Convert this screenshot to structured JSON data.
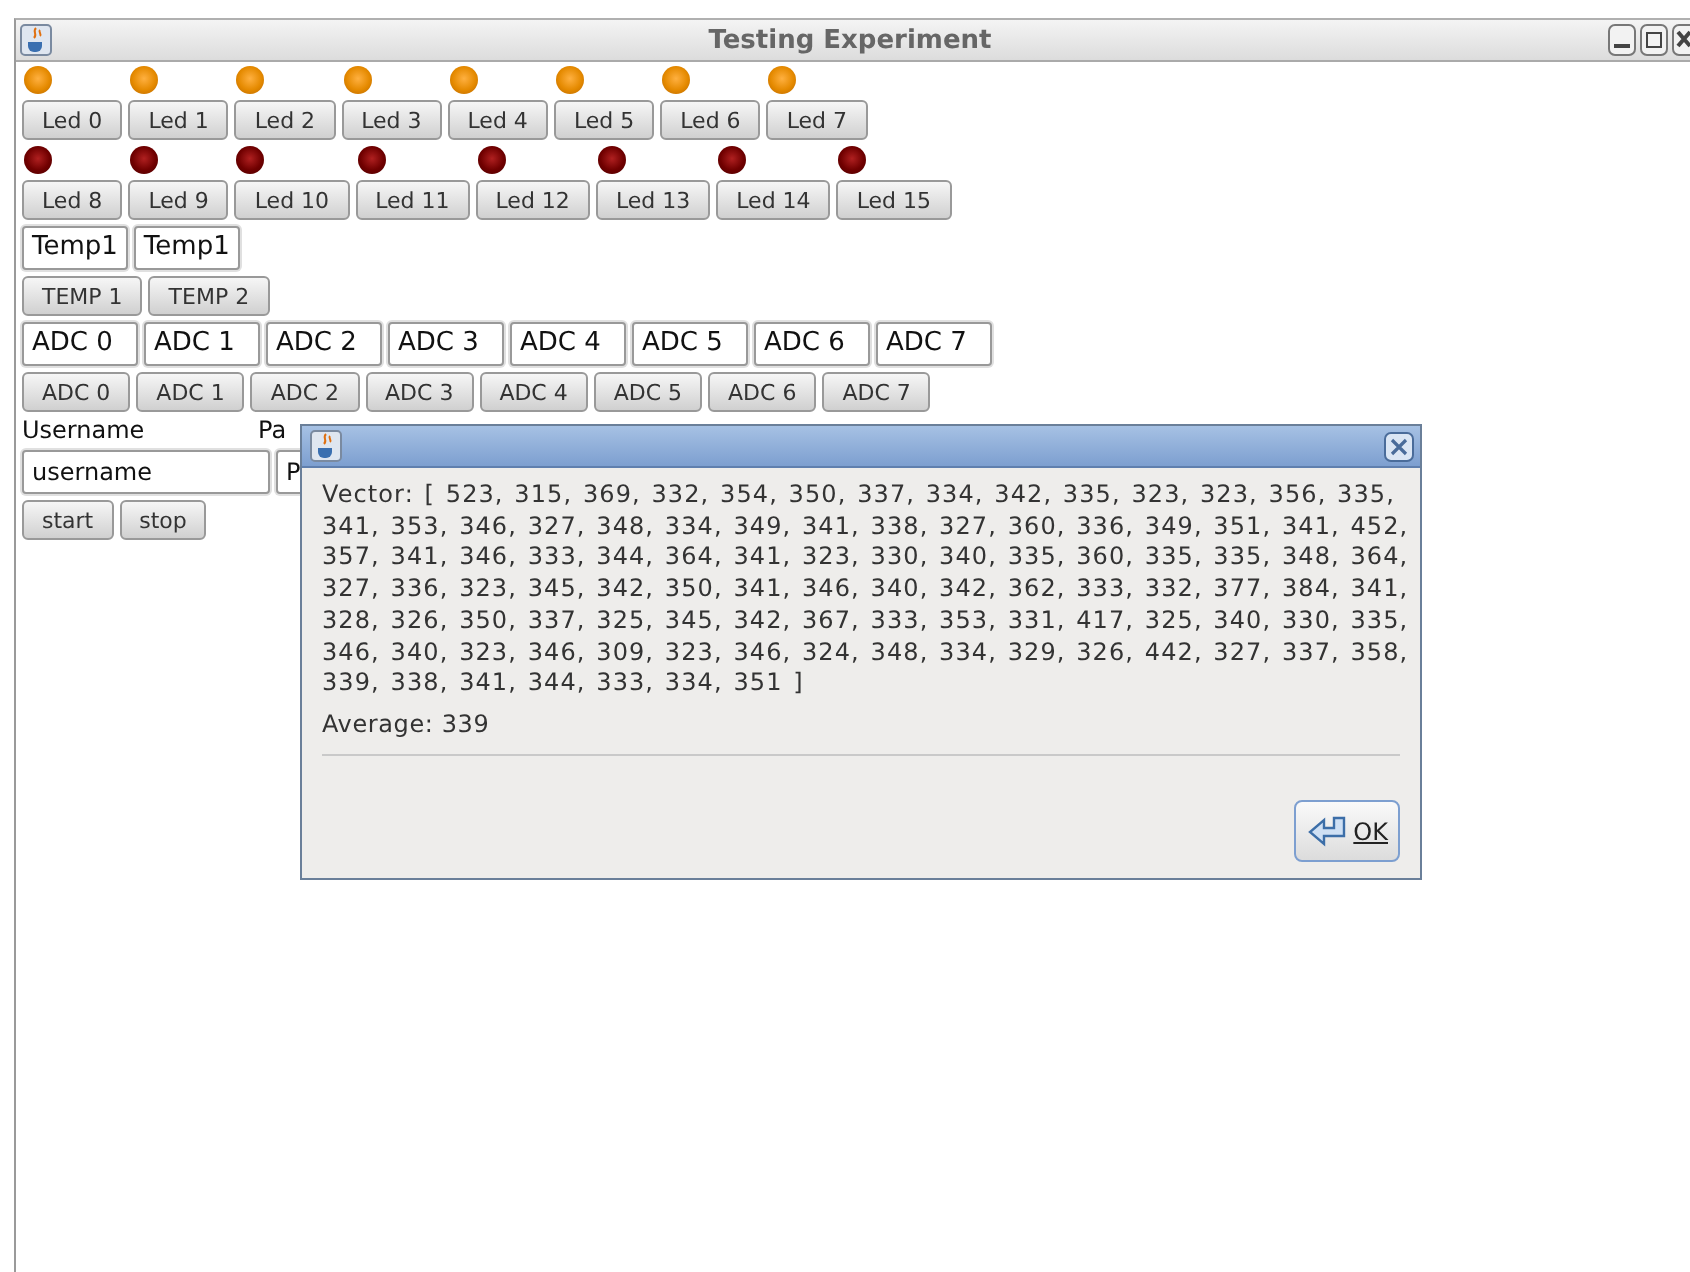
{
  "window": {
    "title": "Testing Experiment"
  },
  "led_rows": [
    {
      "leds": [
        {
          "on": true
        },
        {
          "on": true
        },
        {
          "on": true
        },
        {
          "on": true
        },
        {
          "on": true
        },
        {
          "on": true
        },
        {
          "on": true
        },
        {
          "on": true
        }
      ],
      "buttons": [
        "Led 0",
        "Led 1",
        "Led 2",
        "Led 3",
        "Led 4",
        "Led 5",
        "Led 6",
        "Led 7"
      ]
    },
    {
      "leds": [
        {
          "on": false
        },
        {
          "on": false
        },
        {
          "on": false
        },
        {
          "on": false
        },
        {
          "on": false
        },
        {
          "on": false
        },
        {
          "on": false
        },
        {
          "on": false
        }
      ],
      "buttons": [
        "Led 8",
        "Led 9",
        "Led 10",
        "Led 11",
        "Led 12",
        "Led 13",
        "Led 14",
        "Led 15"
      ]
    }
  ],
  "temp_fields": [
    "Temp1",
    "Temp1"
  ],
  "temp_buttons": [
    "TEMP 1",
    "TEMP 2"
  ],
  "adc_fields": [
    "ADC 0",
    "ADC 1",
    "ADC 2",
    "ADC 3",
    "ADC 4",
    "ADC 5",
    "ADC 6",
    "ADC 7"
  ],
  "adc_buttons": [
    "ADC 0",
    "ADC 1",
    "ADC 2",
    "ADC 3",
    "ADC 4",
    "ADC 5",
    "ADC 6",
    "ADC 7"
  ],
  "username_label": "Username",
  "password_label": "Pa",
  "username_value": "username",
  "password_value": "P",
  "action_buttons": [
    "start",
    "stop"
  ],
  "dialog": {
    "vector_lines": [
      "Vector: [ 523, 315, 369, 332, 354, 350, 337, 334, 342, 335, 323, 323, 356, 335,",
      "341, 353, 346, 327, 348, 334, 349, 341, 338, 327, 360, 336, 349, 351, 341, 452,",
      "357, 341, 346, 333, 344, 364, 341, 323, 330, 340, 335, 360, 335, 335, 348, 364,",
      "327, 336, 323, 345, 342, 350, 341, 346, 340, 342, 362, 333, 332, 377, 384, 341,",
      "328, 326, 350, 337, 325, 345, 342, 367, 333, 353, 331, 417, 325, 340, 330, 335,",
      "346, 340, 323, 346, 309, 323, 346, 324, 348, 334, 329, 326, 442, 327, 337, 358,",
      "339, 338, 341, 344, 333, 334, 351 ]"
    ],
    "average": "Average: 339",
    "ok_button": "OK"
  }
}
